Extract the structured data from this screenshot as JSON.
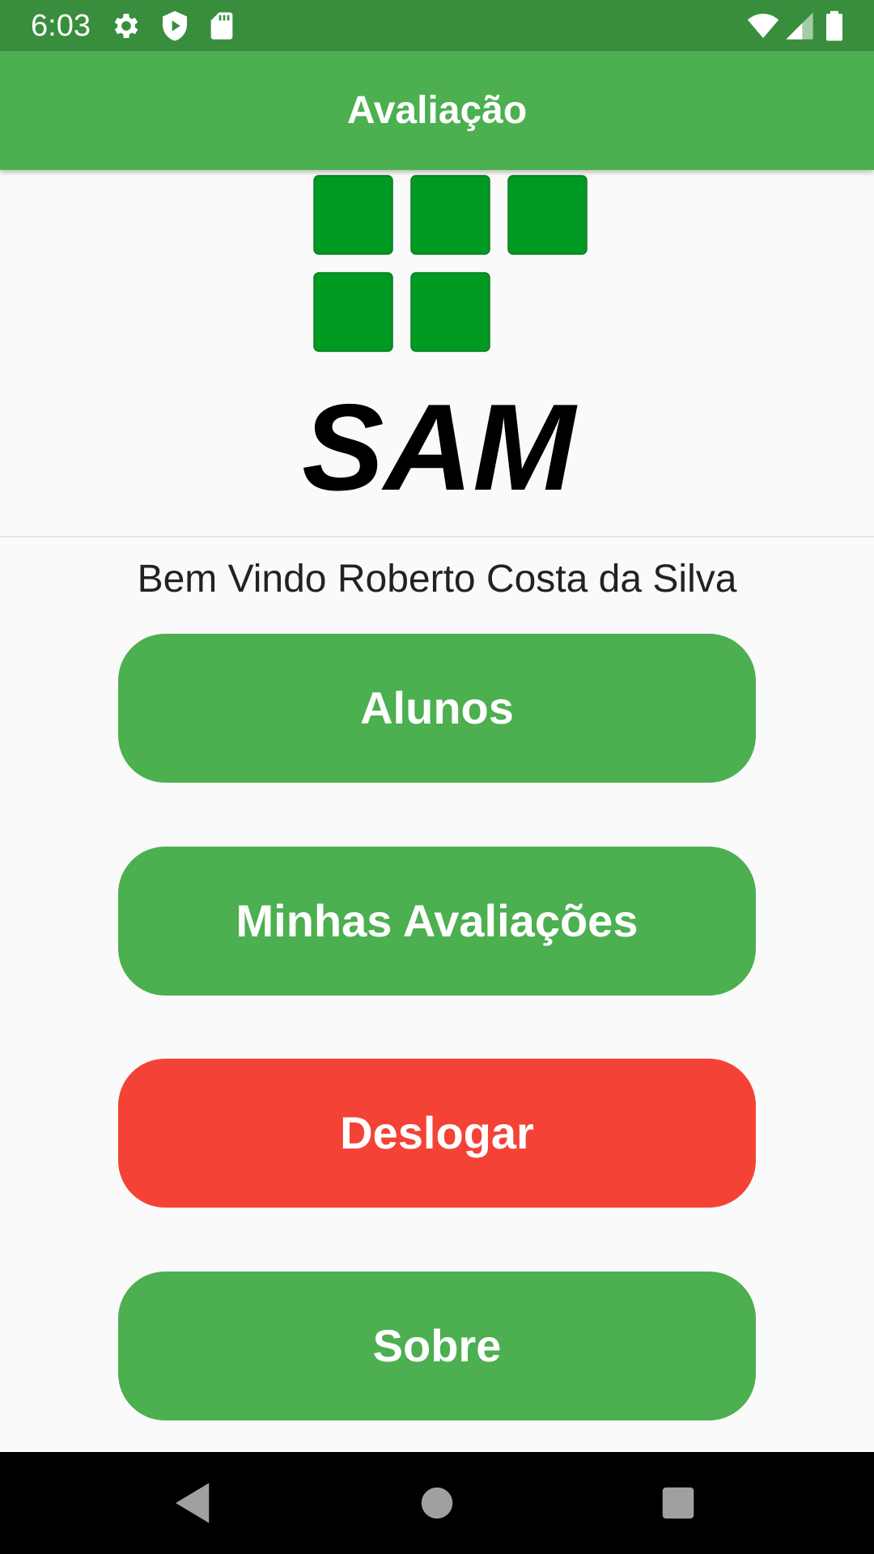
{
  "status_bar": {
    "time": "6:03",
    "left_icons": [
      "gear-icon",
      "shield-play-icon",
      "sd-card-icon"
    ],
    "right_icons": [
      "wifi-icon",
      "signal-icon",
      "battery-icon"
    ],
    "background": "#388e3c"
  },
  "app_bar": {
    "title": "Avaliação",
    "background": "#4caf50"
  },
  "logo": {
    "text": "SAM",
    "square_color": "#009922"
  },
  "welcome": "Bem Vindo Roberto Costa da Silva",
  "buttons": {
    "alunos": "Alunos",
    "minhas_avaliacoes": "Minhas Avaliações",
    "deslogar": "Deslogar",
    "sobre": "Sobre"
  },
  "colors": {
    "primary": "#4caf50",
    "danger": "#f44336"
  },
  "nav_bar": {
    "icons": [
      "back-icon",
      "home-icon",
      "recents-icon"
    ]
  }
}
